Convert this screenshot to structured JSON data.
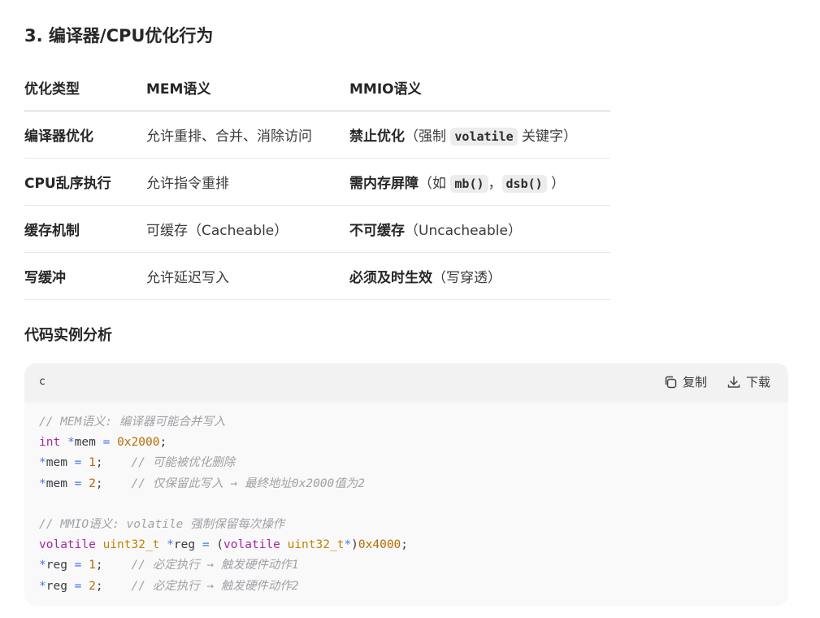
{
  "section_title": "3. 编译器/CPU优化行为",
  "table": {
    "headers": [
      "优化类型",
      "MEM语义",
      "MMIO语义"
    ],
    "rows": [
      {
        "type": "编译器优化",
        "mem": "允许重排、合并、消除访问",
        "mmio_bold": "禁止优化",
        "mmio_pre": "（强制 ",
        "mmio_code1": "volatile",
        "mmio_mid": " 关键字）",
        "mmio_code2": "",
        "mmio_post": ""
      },
      {
        "type": "CPU乱序执行",
        "mem": "允许指令重排",
        "mmio_bold": "需内存屏障",
        "mmio_pre": "（如 ",
        "mmio_code1": "mb()",
        "mmio_mid": "，",
        "mmio_code2": "dsb()",
        "mmio_post": " ）"
      },
      {
        "type": "缓存机制",
        "mem": "可缓存（Cacheable）",
        "mmio_bold": "不可缓存",
        "mmio_pre": "（Uncacheable）",
        "mmio_code1": "",
        "mmio_mid": "",
        "mmio_code2": "",
        "mmio_post": ""
      },
      {
        "type": "写缓冲",
        "mem": "允许延迟写入",
        "mmio_bold": "必须及时生效",
        "mmio_pre": "（写穿透）",
        "mmio_code1": "",
        "mmio_mid": "",
        "mmio_code2": "",
        "mmio_post": ""
      }
    ]
  },
  "subsection_title": "代码实例分析",
  "code_block": {
    "language": "c",
    "copy_label": "复制",
    "download_label": "下载",
    "copy_icon": "copy-icon",
    "download_icon": "download-icon",
    "lines": [
      "// MEM语义: 编译器可能合并写入",
      "int *mem = 0x2000;",
      "*mem = 1;    // 可能被优化删除",
      "*mem = 2;    // 仅保留此写入 → 最终地址0x2000值为2",
      "",
      "// MMIO语义: volatile 强制保留每次操作",
      "volatile uint32_t *reg = (volatile uint32_t*)0x4000;",
      "*reg = 1;    // 必定执行 → 触发硬件动作1",
      "*reg = 2;    // 必定执行 → 触发硬件动作2"
    ]
  },
  "colors": {
    "comment": "#a0a1a7",
    "keyword": "#a626a4",
    "type": "#c18401",
    "operator": "#4078f2",
    "number": "#b76b01"
  }
}
